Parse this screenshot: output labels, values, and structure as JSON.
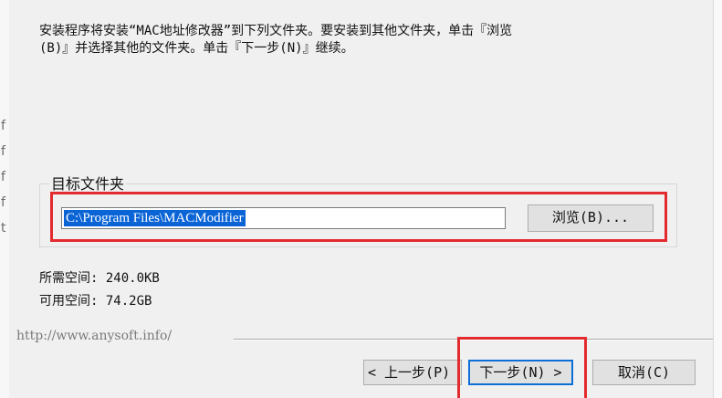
{
  "instructions": {
    "line1": "安装程序将安装“MAC地址修改器”到下列文件夹。要安装到其他文件夹，单击『浏览",
    "line2": "(B)』并选择其他的文件夹。单击『下一步(N)』继续。"
  },
  "destination": {
    "group_label": "目标文件夹",
    "path_value": "C:\\Program Files\\MACModifier",
    "browse_label": "浏览(B)..."
  },
  "space": {
    "required": "所需空间: 240.0KB",
    "available": "可用空间: 74.2GB"
  },
  "footer": {
    "url": "http://www.anysoft.info/"
  },
  "buttons": {
    "back": "< 上一步(P)",
    "next": "下一步(N) >",
    "cancel": "取消(C)"
  },
  "side_fragments": [
    "f",
    "f",
    "f",
    "f",
    "t"
  ],
  "colors": {
    "highlight_box": "#e32b2f",
    "selection": "#0a64d6",
    "default_button_border": "#0b6fd6"
  }
}
